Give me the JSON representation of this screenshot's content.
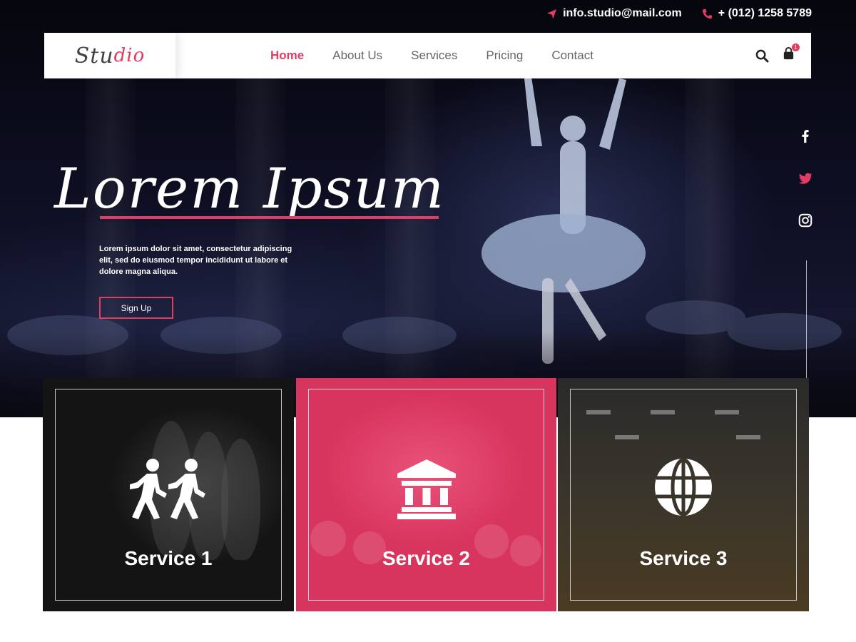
{
  "topbar": {
    "email": "info.studio@mail.com",
    "phone": "+ (012) 1258 5789",
    "email_icon": "paper-plane-icon",
    "phone_icon": "phone-icon"
  },
  "nav": {
    "logo": {
      "part1": "Stu",
      "part2": "dio"
    },
    "items": [
      {
        "label": "Home",
        "active": true
      },
      {
        "label": "About Us",
        "active": false
      },
      {
        "label": "Services",
        "active": false
      },
      {
        "label": "Pricing",
        "active": false
      },
      {
        "label": "Contact",
        "active": false
      }
    ],
    "search_icon": "search-icon",
    "cart_icon": "shopping-bag-icon",
    "cart_count": "1"
  },
  "hero": {
    "title": "Lorem Ipsum",
    "description": "Lorem ipsum dolor sit amet, consectetur adipiscing elit, sed do eiusmod tempor incididunt ut labore et dolore magna aliqua.",
    "button": "Sign Up"
  },
  "social": [
    "facebook-icon",
    "twitter-icon",
    "instagram-icon"
  ],
  "services": [
    {
      "label": "Service 1",
      "icon": "walking-people-icon"
    },
    {
      "label": "Service 2",
      "icon": "landmark-icon"
    },
    {
      "label": "Service 3",
      "icon": "globe-icon"
    }
  ],
  "colors": {
    "accent": "#e23b64",
    "nav_bg": "#ffffff",
    "hero_bg": "#0d0e22"
  }
}
